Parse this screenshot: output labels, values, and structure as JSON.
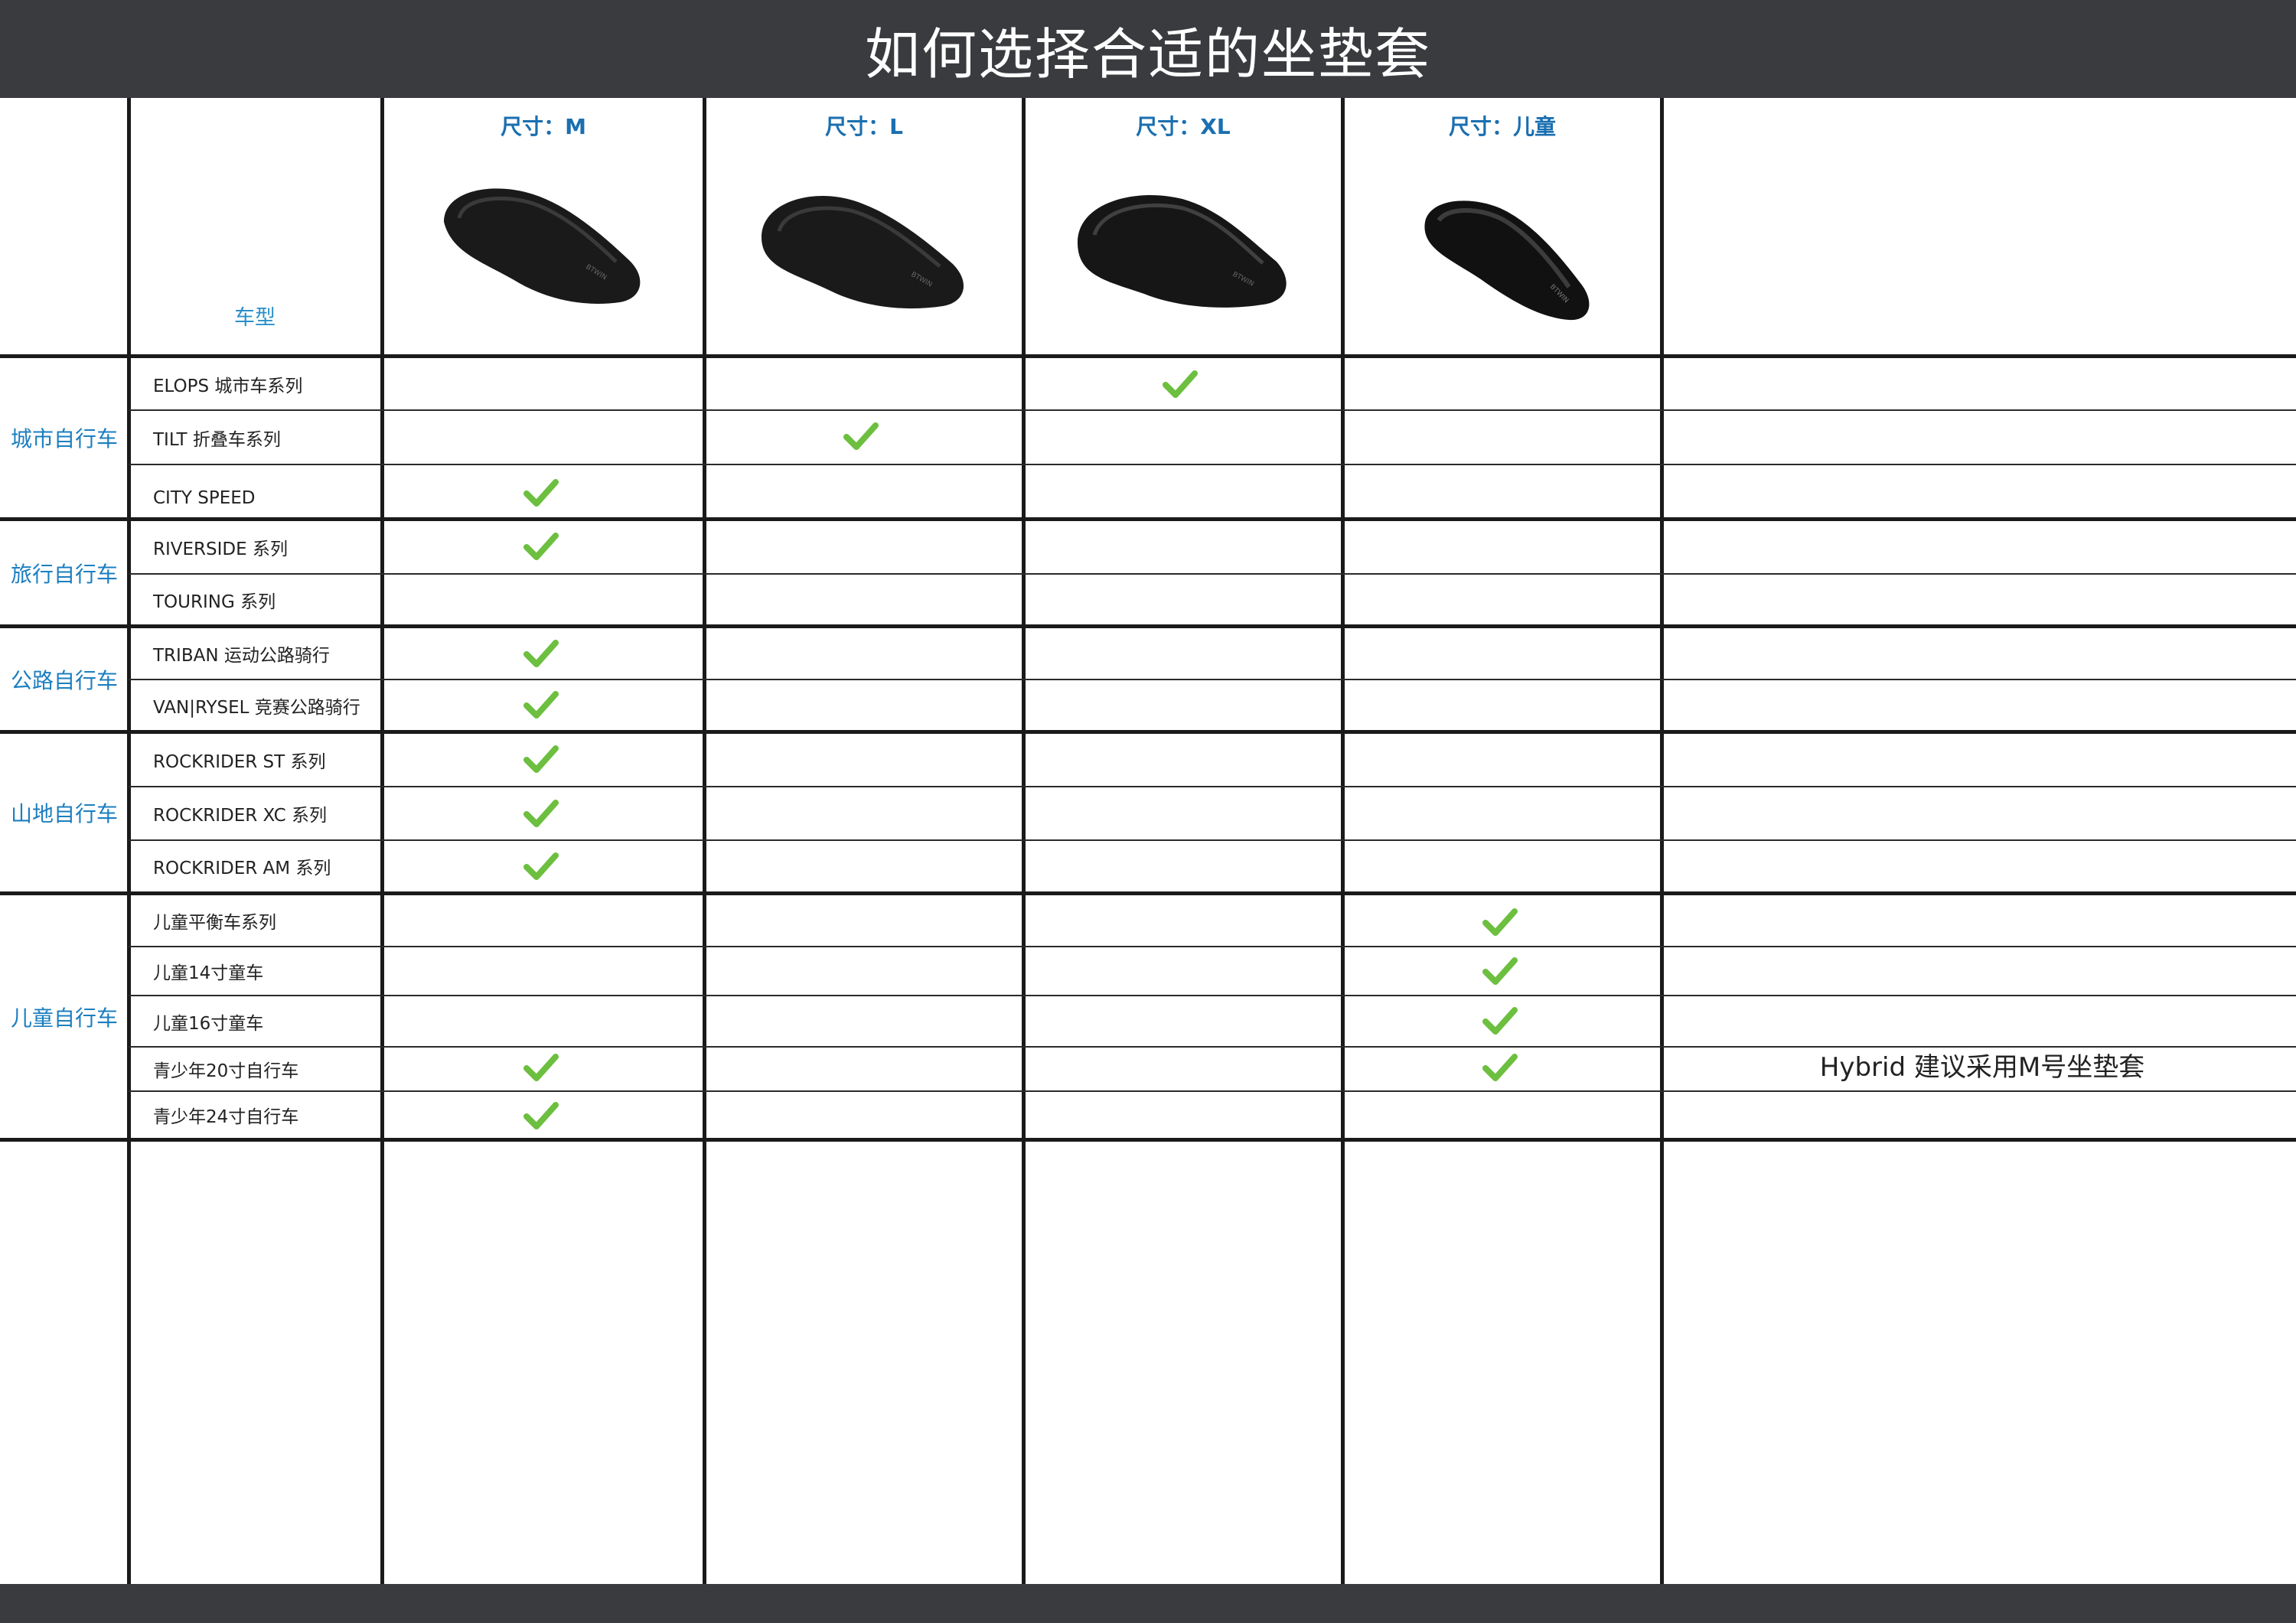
{
  "title": "如何选择合适的坐垫套",
  "vehicle_type_label": "车型",
  "sizes": [
    {
      "label": "尺寸：M"
    },
    {
      "label": "尺寸：L"
    },
    {
      "label": "尺寸：XL"
    },
    {
      "label": "尺寸：儿童"
    }
  ],
  "categories": [
    {
      "label": "城市自行车"
    },
    {
      "label": "旅行自行车"
    },
    {
      "label": "公路自行车"
    },
    {
      "label": "山地自行车"
    },
    {
      "label": "儿童自行车"
    }
  ],
  "models": [
    {
      "name": "ELOPS 城市车系列",
      "category": 0,
      "fits": [
        "XL"
      ]
    },
    {
      "name": "TILT 折叠车系列",
      "category": 0,
      "fits": [
        "L"
      ]
    },
    {
      "name": "CITY SPEED",
      "category": 0,
      "fits": [
        "M"
      ]
    },
    {
      "name": "RIVERSIDE  系列",
      "category": 1,
      "fits": [
        "M"
      ]
    },
    {
      "name": "TOURING 系列",
      "category": 1,
      "fits": []
    },
    {
      "name": "TRIBAN 运动公路骑行",
      "category": 2,
      "fits": [
        "M"
      ]
    },
    {
      "name": "VAN|RYSEL 竞赛公路骑行",
      "category": 2,
      "fits": [
        "M"
      ]
    },
    {
      "name": "ROCKRIDER ST 系列",
      "category": 3,
      "fits": [
        "M"
      ]
    },
    {
      "name": "ROCKRIDER XC 系列",
      "category": 3,
      "fits": [
        "M"
      ]
    },
    {
      "name": "ROCKRIDER AM 系列",
      "category": 3,
      "fits": [
        "M"
      ]
    },
    {
      "name": "儿童平衡车系列",
      "category": 4,
      "fits": [
        "儿童"
      ]
    },
    {
      "name": "儿童14寸童车",
      "category": 4,
      "fits": [
        "儿童"
      ]
    },
    {
      "name": "儿童16寸童车",
      "category": 4,
      "fits": [
        "儿童"
      ]
    },
    {
      "name": "青少年20寸自行车",
      "category": 4,
      "fits": [
        "M",
        "儿童"
      ]
    },
    {
      "name": "青少年24寸自行车",
      "category": 4,
      "fits": [
        "M"
      ]
    }
  ],
  "note": "Hybrid 建议采用M号坐垫套",
  "colors": {
    "header_bg": "#3a3b3f",
    "header_text": "#ffffff",
    "size_label": "#1a6fb0",
    "category_label": "#1c7fc0",
    "check": "#6cbf3f",
    "grid": "#1a1a1a"
  },
  "icons": {
    "fit": "checkmark-icon",
    "product": "saddle-cover-image"
  }
}
